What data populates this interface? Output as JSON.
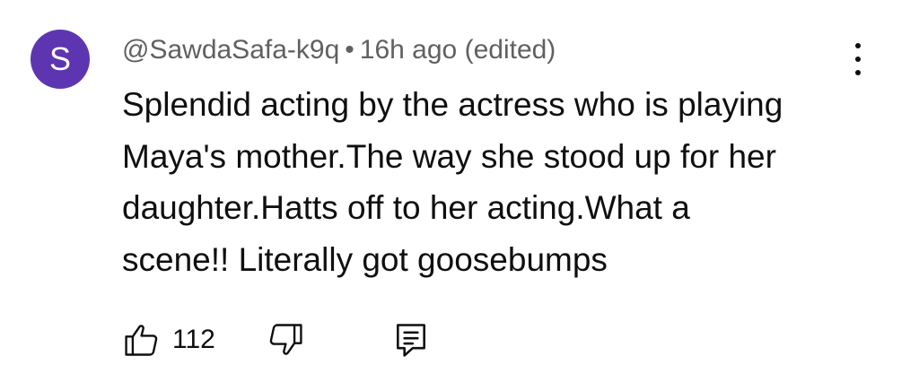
{
  "comment": {
    "avatar_letter": "S",
    "avatar_color": "#5e35b1",
    "author": "@SawdaSafa-k9q",
    "separator": "•",
    "timestamp": "16h ago",
    "edited_label": "(edited)",
    "lines": [
      "Splendid acting by the actress who is playing",
      "Maya's mother.The way she stood up for her",
      "daughter.Hatts off to her acting.What a",
      "scene!! Literally got goosebumps"
    ],
    "like_count": "112",
    "icons": {
      "menu": "more-vertical-icon",
      "like": "thumbs-up-icon",
      "dislike": "thumbs-down-icon",
      "reply": "reply-comment-icon"
    }
  }
}
